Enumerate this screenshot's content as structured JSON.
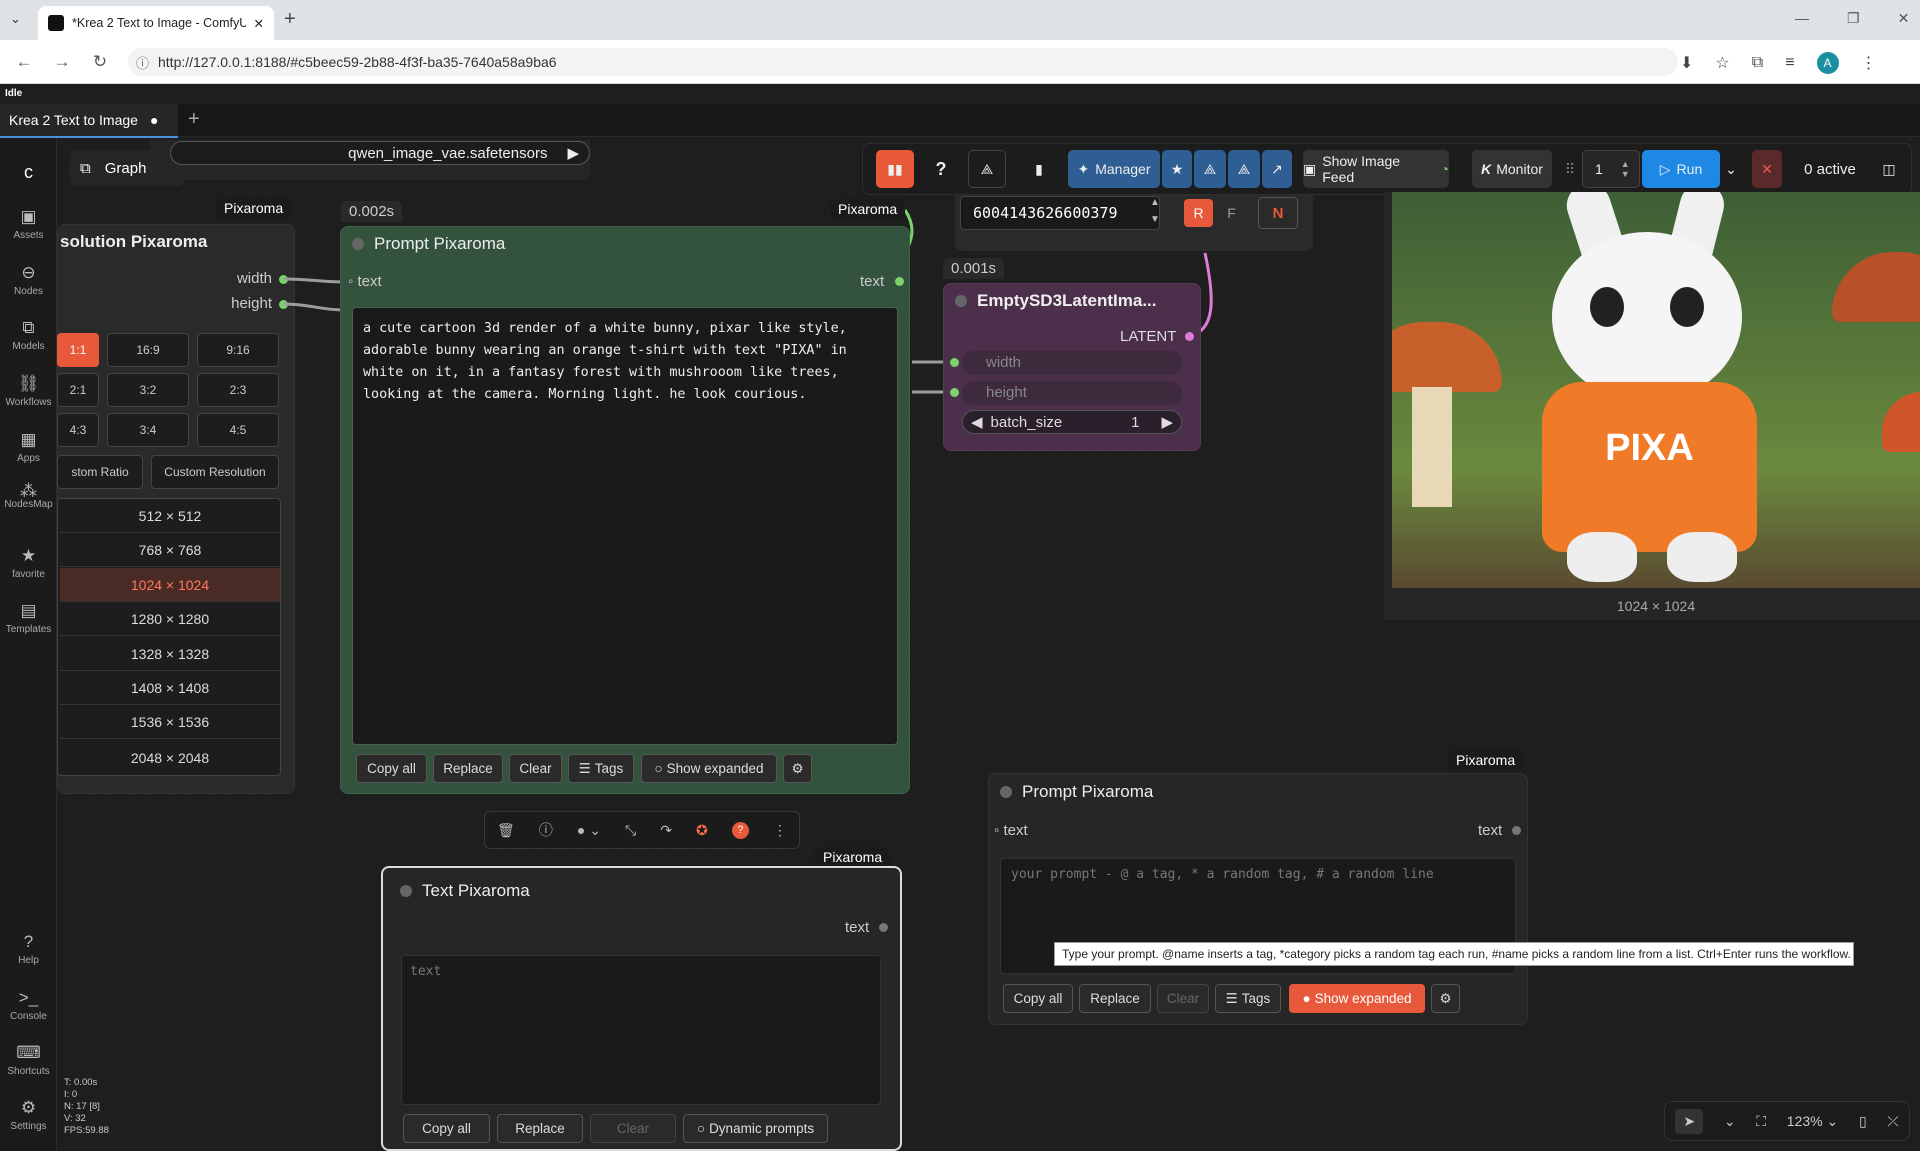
{
  "browser": {
    "tab_title": "*Krea 2 Text to Image - ComfyUI",
    "url": "http://127.0.0.1:8188/#c5beec59-2b88-4f3f-ba35-7640a58a9ba6",
    "profile_initial": "A"
  },
  "app": {
    "status": "Idle",
    "workflow_tab": "Krea 2 Text to Image",
    "graph_label": "Graph",
    "vae_value": "qwen_image_vae.safetensors",
    "stats": "T: 0.00s\nI: 0\nN: 17 [8]\nV: 32\nFPS:59.88",
    "zoom": "123%"
  },
  "sidebar": {
    "items": [
      "Assets",
      "Nodes",
      "Models",
      "Workflows",
      "Apps",
      "NodesMap",
      "favorite",
      "Templates",
      "Help",
      "Console",
      "Shortcuts",
      "Settings"
    ]
  },
  "toolbar": {
    "manager": "Manager",
    "image_feed": "Show Image Feed",
    "monitor": "Monitor",
    "queue_count": "1",
    "run": "Run",
    "active": "0 active"
  },
  "seed": {
    "value": "6004143626600379",
    "r": "R",
    "f": "F",
    "n": "N"
  },
  "resolution_node": {
    "badge": "Pixaroma",
    "title": "solution Pixaroma",
    "out_width": "width",
    "out_height": "height",
    "ratios": [
      "1:1",
      "16:9",
      "9:16",
      "2:1",
      "3:2",
      "2:3",
      "4:3",
      "3:4",
      "4:5"
    ],
    "custom_ratio": "stom Ratio",
    "custom_resolution": "Custom Resolution",
    "sizes": [
      "512 × 512",
      "768 × 768",
      "1024 × 1024",
      "1280 × 1280",
      "1328 × 1328",
      "1408 × 1408",
      "1536 × 1536",
      "2048 × 2048"
    ],
    "selected": "1024 × 1024"
  },
  "prompt_node": {
    "timing": "0.002s",
    "badge": "Pixaroma",
    "title": "Prompt Pixaroma",
    "in": "text",
    "out": "text",
    "text": "a cute cartoon 3d render of a white bunny, pixar like style,\nadorable bunny wearing an orange t-shirt with text \"PIXA\" in\nwhite on it, in a fantasy forest with mushrooom like trees,\nlooking at the camera. Morning light. he look courious.",
    "buttons": {
      "copy": "Copy all",
      "replace": "Replace",
      "clear": "Clear",
      "tags": "Tags",
      "expanded": "Show expanded"
    }
  },
  "latent_node": {
    "timing": "0.001s",
    "title": "EmptySD3LatentIma...",
    "out": "LATENT",
    "width": "width",
    "height": "height",
    "batch_label": "batch_size",
    "batch_value": "1"
  },
  "preview": {
    "caption": "1024 × 1024",
    "shirt_text": "PIXA"
  },
  "prompt_node2": {
    "badge": "Pixaroma",
    "title": "Prompt Pixaroma",
    "in": "text",
    "out": "text",
    "placeholder": "your prompt - @ a tag, * a random tag, # a random line",
    "tooltip": "Type your prompt. @name inserts a tag, *category picks a random tag each run, #name picks a random line from a list. Ctrl+Enter runs the workflow.",
    "buttons": {
      "copy": "Copy all",
      "replace": "Replace",
      "clear": "Clear",
      "tags": "Tags",
      "expanded": "Show expanded"
    }
  },
  "text_node": {
    "badge": "Pixaroma",
    "title": "Text Pixaroma",
    "out": "text",
    "placeholder": "text",
    "buttons": {
      "copy": "Copy all",
      "replace": "Replace",
      "clear": "Clear",
      "dynamic": "Dynamic prompts"
    }
  }
}
